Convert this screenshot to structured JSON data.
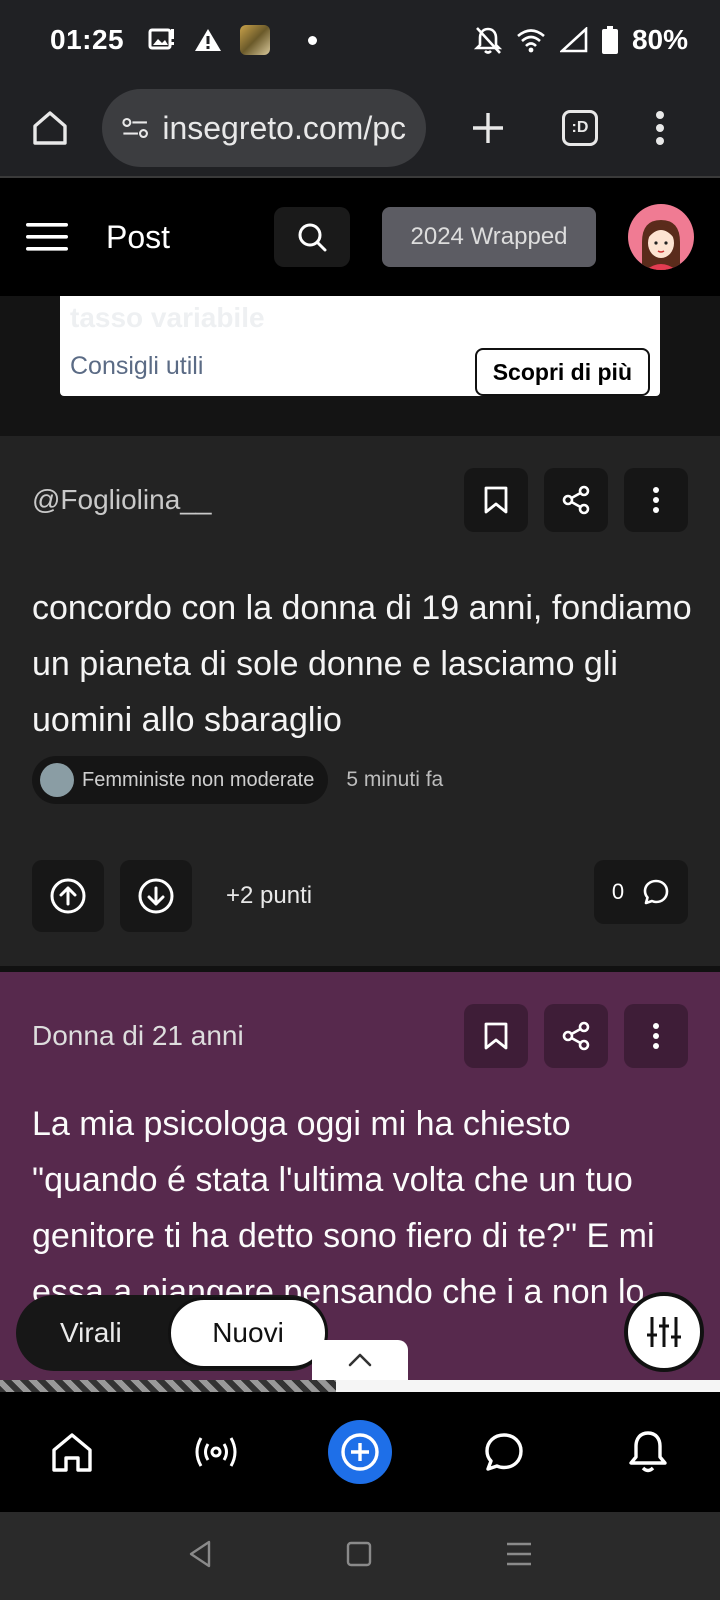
{
  "status_bar": {
    "time": "01:25",
    "battery": "80%",
    "icons": [
      "image-icon",
      "warning-icon",
      "app-thumbnail-icon",
      "dot-icon",
      "mute-icon",
      "wifi-icon",
      "signal-icon",
      "battery-icon"
    ]
  },
  "browser": {
    "url": "insegreto.com/pc",
    "tab_count": ":D"
  },
  "header": {
    "title": "Post",
    "wrapped_label": "2024 Wrapped"
  },
  "ad": {
    "faded_text": "tasso variabile",
    "tip_text": "Consigli utili",
    "cta_label": "Scopri di più"
  },
  "posts": [
    {
      "author": "@Fogliolina__",
      "body": "concordo con la donna di 19 anni, fondiamo un pianeta di sole donne e lasciamo gli uomini allo sbaraglio",
      "tag": "Femministe non moderate",
      "time": "5 minuti fa",
      "points": "+2 punti",
      "comments": "0"
    },
    {
      "author": "Donna di 21 anni",
      "body": "La mia psicologa oggi mi ha chiesto \"quando é stata l'ultima volta che un tuo genitore ti ha detto sono fiero di te?\" E mi essa a piangere pensando che i a non lo hanno"
    }
  ],
  "feed_tabs": {
    "virali": "Virali",
    "nuovi": "Nuovi"
  },
  "colors": {
    "post_purple": "#57294d",
    "accent_blue": "#1e6fe8",
    "header_black": "#000000"
  }
}
